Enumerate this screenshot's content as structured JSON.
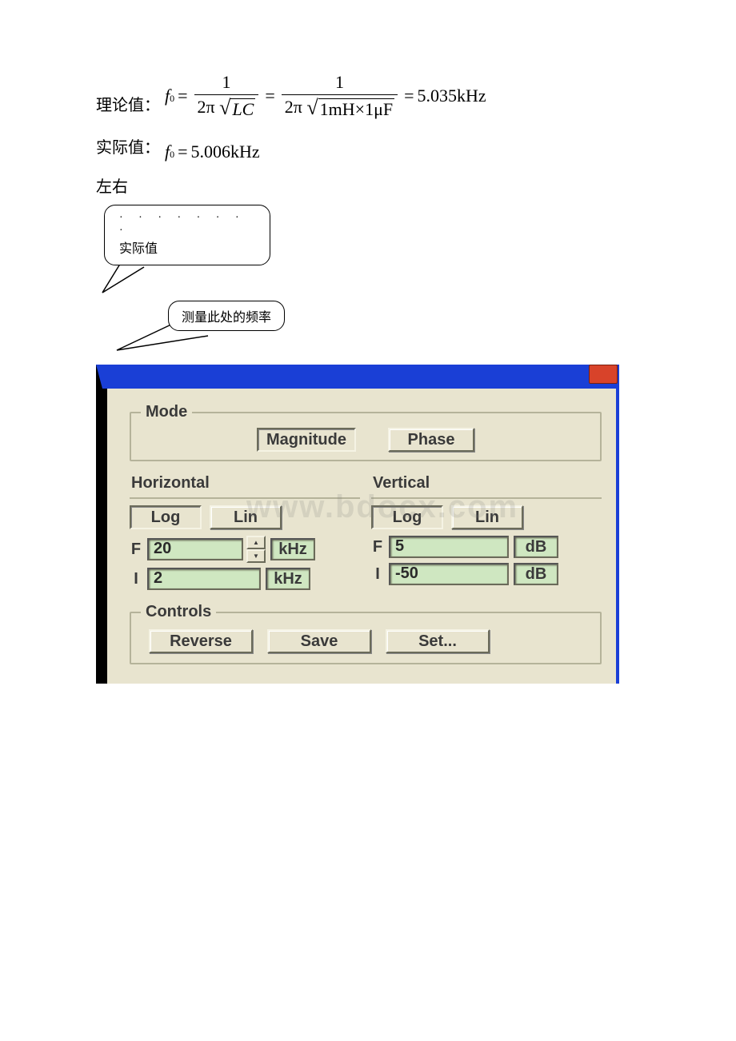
{
  "text": {
    "theory_label": "理论值：",
    "actual_label": "实际值：",
    "approx": "左右",
    "formula_prefix_f": "f",
    "formula_sub0": "0",
    "formula_eq": "=",
    "frac1_num": "1",
    "frac1_den_pre": "2π",
    "frac1_den_rad": "LC",
    "frac2_num": "1",
    "frac2_den_pre": "2π",
    "frac2_den_rad": "1mH×1μF",
    "result1": "5.035kHz",
    "actual_formula": "5.006kHz",
    "bubble1_dots": "·  ·  ·  ·  ·  ·  ·  ·",
    "bubble1_text": "实际值",
    "bubble2_text": "测量此处的频率"
  },
  "dialog": {
    "mode": {
      "legend": "Mode",
      "magnitude": "Magnitude",
      "phase": "Phase"
    },
    "horizontal": {
      "title": "Horizontal",
      "log": "Log",
      "lin": "Lin",
      "F_value": "20",
      "F_unit": "kHz",
      "I_value": "2",
      "I_unit": "kHz"
    },
    "vertical": {
      "title": "Vertical",
      "log": "Log",
      "lin": "Lin",
      "F_value": "5",
      "F_unit": "dB",
      "I_value": "-50",
      "I_unit": "dB"
    },
    "labels": {
      "F": "F",
      "I": "I"
    },
    "controls": {
      "legend": "Controls",
      "reverse": "Reverse",
      "save": "Save",
      "set": "Set..."
    },
    "watermark": "www.bdocx.com"
  }
}
